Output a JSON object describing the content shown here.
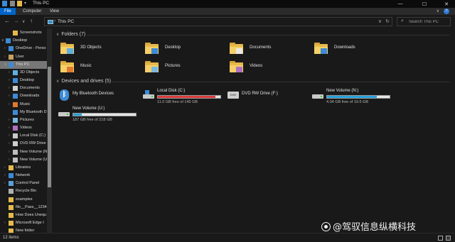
{
  "window": {
    "title": "This PC",
    "controls": {
      "minimize": "—",
      "maximize": "☐",
      "close": "✕"
    }
  },
  "ribbon": {
    "tabs": [
      "File",
      "Computer",
      "View"
    ],
    "active_tab": "File",
    "collapse": "∨",
    "help": "?"
  },
  "navigation": {
    "back": "←",
    "forward": "→",
    "recent": "∨",
    "up": "↑",
    "separator": "›",
    "location": "This PC",
    "dropdown": "∨",
    "refresh": "↻"
  },
  "search": {
    "placeholder": "Search This PC",
    "icon": "⌕"
  },
  "sidebar": {
    "items": [
      {
        "label": "Screenshots",
        "icon": "folder",
        "level": 2,
        "chev": ""
      },
      {
        "label": "Desktop",
        "icon": "desktop-blue",
        "level": 0,
        "chev": "∨"
      },
      {
        "label": "OneDrive - Perso",
        "icon": "cloud",
        "level": 1,
        "chev": "›"
      },
      {
        "label": "User",
        "icon": "user",
        "level": 1,
        "chev": "›"
      },
      {
        "label": "This PC",
        "icon": "pc",
        "level": 1,
        "chev": "∨",
        "selected": true
      },
      {
        "label": "3D Objects",
        "icon": "3d",
        "level": 2,
        "chev": "›"
      },
      {
        "label": "Desktop",
        "icon": "desktop-blue",
        "level": 2,
        "chev": "›"
      },
      {
        "label": "Documents",
        "icon": "documents",
        "level": 2,
        "chev": "›"
      },
      {
        "label": "Downloads",
        "icon": "downloads",
        "level": 2,
        "chev": "›"
      },
      {
        "label": "Music",
        "icon": "music",
        "level": 2,
        "chev": "›"
      },
      {
        "label": "My Bluetooth D",
        "icon": "bluetooth",
        "level": 2,
        "chev": ""
      },
      {
        "label": "Pictures",
        "icon": "pictures",
        "level": 2,
        "chev": "›"
      },
      {
        "label": "Videos",
        "icon": "videos",
        "level": 2,
        "chev": "›"
      },
      {
        "label": "Local Disk (C:)",
        "icon": "drive-win",
        "level": 2,
        "chev": "›"
      },
      {
        "label": "DVD RW Drive",
        "icon": "dvd",
        "level": 2,
        "chev": "›"
      },
      {
        "label": "New Volume (N",
        "icon": "drive",
        "level": 2,
        "chev": "›"
      },
      {
        "label": "New Volume (U",
        "icon": "drive",
        "level": 2,
        "chev": "›"
      },
      {
        "label": "Libraries",
        "icon": "libraries",
        "level": 1,
        "chev": "›"
      },
      {
        "label": "Network",
        "icon": "network",
        "level": 1,
        "chev": "›"
      },
      {
        "label": "Control Panel",
        "icon": "control-panel",
        "level": 1,
        "chev": "›"
      },
      {
        "label": "Recycle Bin",
        "icon": "recycle",
        "level": 1,
        "chev": ""
      },
      {
        "label": "examples",
        "icon": "folder",
        "level": 1,
        "chev": ""
      },
      {
        "label": "file__Pass__1234",
        "icon": "folder",
        "level": 1,
        "chev": ""
      },
      {
        "label": "How Does Unequ",
        "icon": "folder",
        "level": 1,
        "chev": ""
      },
      {
        "label": "Microsoft Edge I",
        "icon": "folder",
        "level": 1,
        "chev": "›"
      },
      {
        "label": "New folder",
        "icon": "folder",
        "level": 1,
        "chev": ""
      }
    ]
  },
  "folders": {
    "title": "Folders (7)",
    "chev": "∨",
    "items": [
      {
        "label": "3D Objects",
        "badge": "3d"
      },
      {
        "label": "Desktop",
        "badge": "desktop"
      },
      {
        "label": "Documents",
        "badge": "documents"
      },
      {
        "label": "Downloads",
        "badge": "downloads"
      },
      {
        "label": "Music",
        "badge": "music"
      },
      {
        "label": "Pictures",
        "badge": "pictures"
      },
      {
        "label": "Videos",
        "badge": "videos"
      }
    ]
  },
  "drives": {
    "title": "Devices and drives (5)",
    "chev": "∨",
    "items": [
      {
        "label": "My Bluetooth Devices",
        "icon": "bluetooth",
        "free": "",
        "used_fraction": null
      },
      {
        "label": "Local Disk (C:)",
        "icon": "drive-win",
        "free": "11.0 GB free of 145 GB",
        "used_fraction": 0.92,
        "bar_color": "#da3b3b"
      },
      {
        "label": "DVD RW Drive (F:)",
        "icon": "dvd",
        "free": "",
        "used_fraction": null
      },
      {
        "label": "New Volume (N:)",
        "icon": "drive",
        "free": "4.04 GB free of 19.5 GB",
        "used_fraction": 0.79,
        "bar_color": "#26a0da"
      },
      {
        "label": "New Volume (U:)",
        "icon": "drive",
        "free": "187 GB free of 218 GB",
        "used_fraction": 0.14,
        "bar_color": "#26a0da"
      }
    ]
  },
  "status": {
    "count": "12 items"
  },
  "watermark": {
    "text": "@驾驭信息纵横科技"
  },
  "colors": {
    "accent": "#0064c8",
    "critical": "#da3b3b",
    "normal": "#26a0da",
    "folder": "#f5cf67"
  }
}
